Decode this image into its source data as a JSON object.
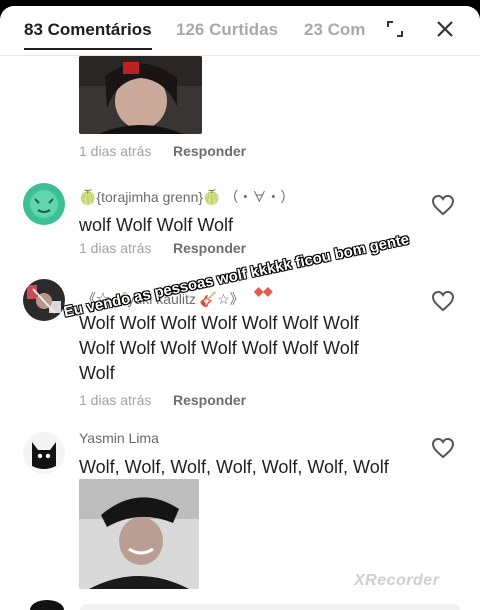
{
  "header": {
    "tabs": [
      {
        "label": "83 Comentários",
        "active": true
      },
      {
        "label": "126 Curtidas",
        "active": false
      },
      {
        "label": "23 Com",
        "active": false
      }
    ],
    "icons": [
      "expand-icon",
      "close-icon"
    ]
  },
  "first_comment": {
    "date": "1 dias atrás",
    "reply": "Responder"
  },
  "comments": [
    {
      "username": "🍈{torajimha grenn}🍈 （・∀・）",
      "text": "wolf Wolf Wolf Wolf",
      "date": "1 dias atrás",
      "reply": "Responder"
    },
    {
      "username": "《☆🎸yuki kaulitz 🎸☆》",
      "text": "Wolf Wolf Wolf Wolf Wolf Wolf Wolf Wolf Wolf Wolf Wolf Wolf Wolf Wolf Wolf",
      "date": "1 dias atrás",
      "reply": "Responder"
    },
    {
      "username": "Yasmin Lima",
      "text": "Wolf, Wolf, Wolf, Wolf, Wolf, Wolf, Wolf"
    }
  ],
  "overlay_caption": "Eu vendo as pessoas wolf kkkkk ficou bom gente",
  "watermark": "XRecorder",
  "colors": {
    "active_tab": "#1d1d1d",
    "inactive_tab": "#a9a9a9",
    "muted": "#a2a2a2"
  }
}
